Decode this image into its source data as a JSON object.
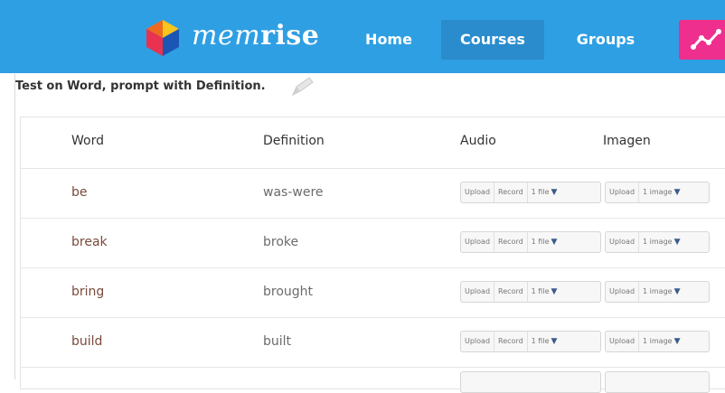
{
  "header": {
    "brand_part1": "mem",
    "brand_part2": "rise",
    "nav": {
      "home": "Home",
      "courses": "Courses",
      "groups": "Groups"
    }
  },
  "prompt": "Test on Word, prompt with Definition.",
  "table": {
    "columns": [
      "Word",
      "Definition",
      "Audio",
      "Imagen"
    ],
    "rows": [
      {
        "word": "be",
        "definition": "was-were"
      },
      {
        "word": "break",
        "definition": "broke"
      },
      {
        "word": "bring",
        "definition": "brought"
      },
      {
        "word": "build",
        "definition": "built"
      }
    ],
    "audio_controls": {
      "upload": "Upload",
      "record": "Record",
      "files": "1 file"
    },
    "image_controls": {
      "upload": "Upload",
      "images": "1 image"
    }
  },
  "colors": {
    "topbar": "#2f9fe3",
    "active_nav": "#2a8ccd",
    "pink_button": "#ee2f8e"
  }
}
